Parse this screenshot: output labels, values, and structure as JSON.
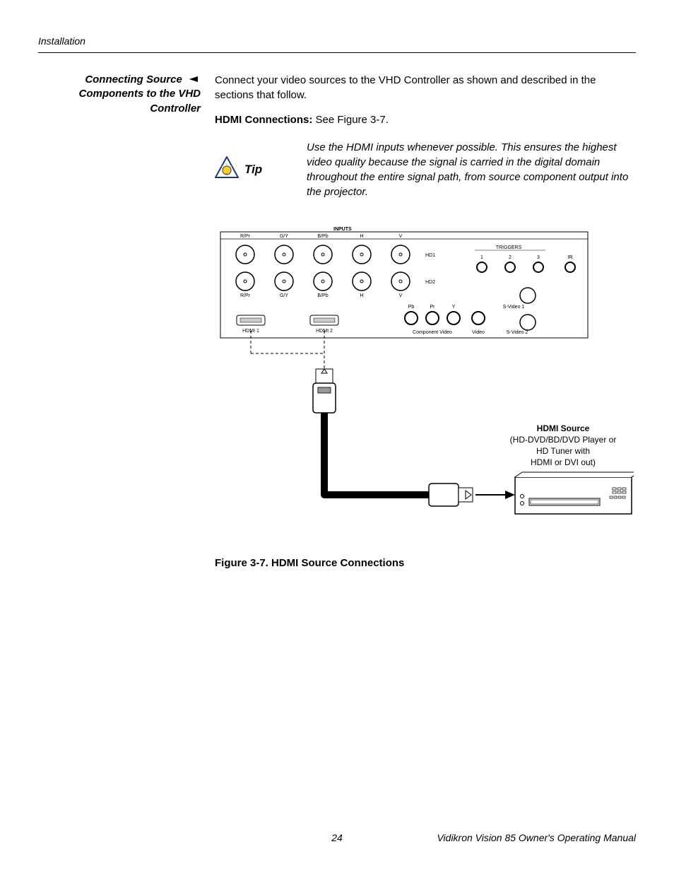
{
  "header": {
    "chapter": "Installation"
  },
  "sidebar": {
    "section_title": "Connecting Source Components to the VHD Controller"
  },
  "body": {
    "intro": "Connect your video sources to the VHD Controller as shown and described in the sections that follow.",
    "hdmi_label": "HDMI Connections: ",
    "hdmi_text": "See Figure 3-7.",
    "tip_label": "Tip",
    "tip_text": "Use the HDMI inputs whenever possible. This ensures the highest video quality because the signal is carried in the digital domain throughout the entire signal path, from source component output into the projector.",
    "figure_caption": "Figure 3-7. HDMI Source Connections"
  },
  "diagram": {
    "inputs_header": "INPUTS",
    "top_labels": {
      "rpr": "R/Pr",
      "gy": "G/Y",
      "bpb": "B/Pb",
      "h": "H",
      "v": "V"
    },
    "row_labels": {
      "hd1": "HD1",
      "hd2": "HD2"
    },
    "hdmi_ports": {
      "p1": "HDMI 1",
      "p2": "HDMI 2"
    },
    "triggers": {
      "header": "TRIGGERS",
      "t1": "1",
      "t2": "2",
      "t3": "3",
      "ir": "IR"
    },
    "component": {
      "pb": "Pb",
      "pr": "Pr",
      "y": "Y",
      "label": "Component Video"
    },
    "svideo": {
      "sv1": "S-Video 1",
      "sv2": "S-Video 2",
      "video": "Video"
    },
    "source": {
      "title": "HDMI Source",
      "line1": "(HD-DVD/BD/DVD Player or",
      "line2": "HD Tuner with",
      "line3": "HDMI or DVI out)"
    }
  },
  "footer": {
    "page": "24",
    "manual": "Vidikron Vision 85 Owner's Operating Manual"
  }
}
